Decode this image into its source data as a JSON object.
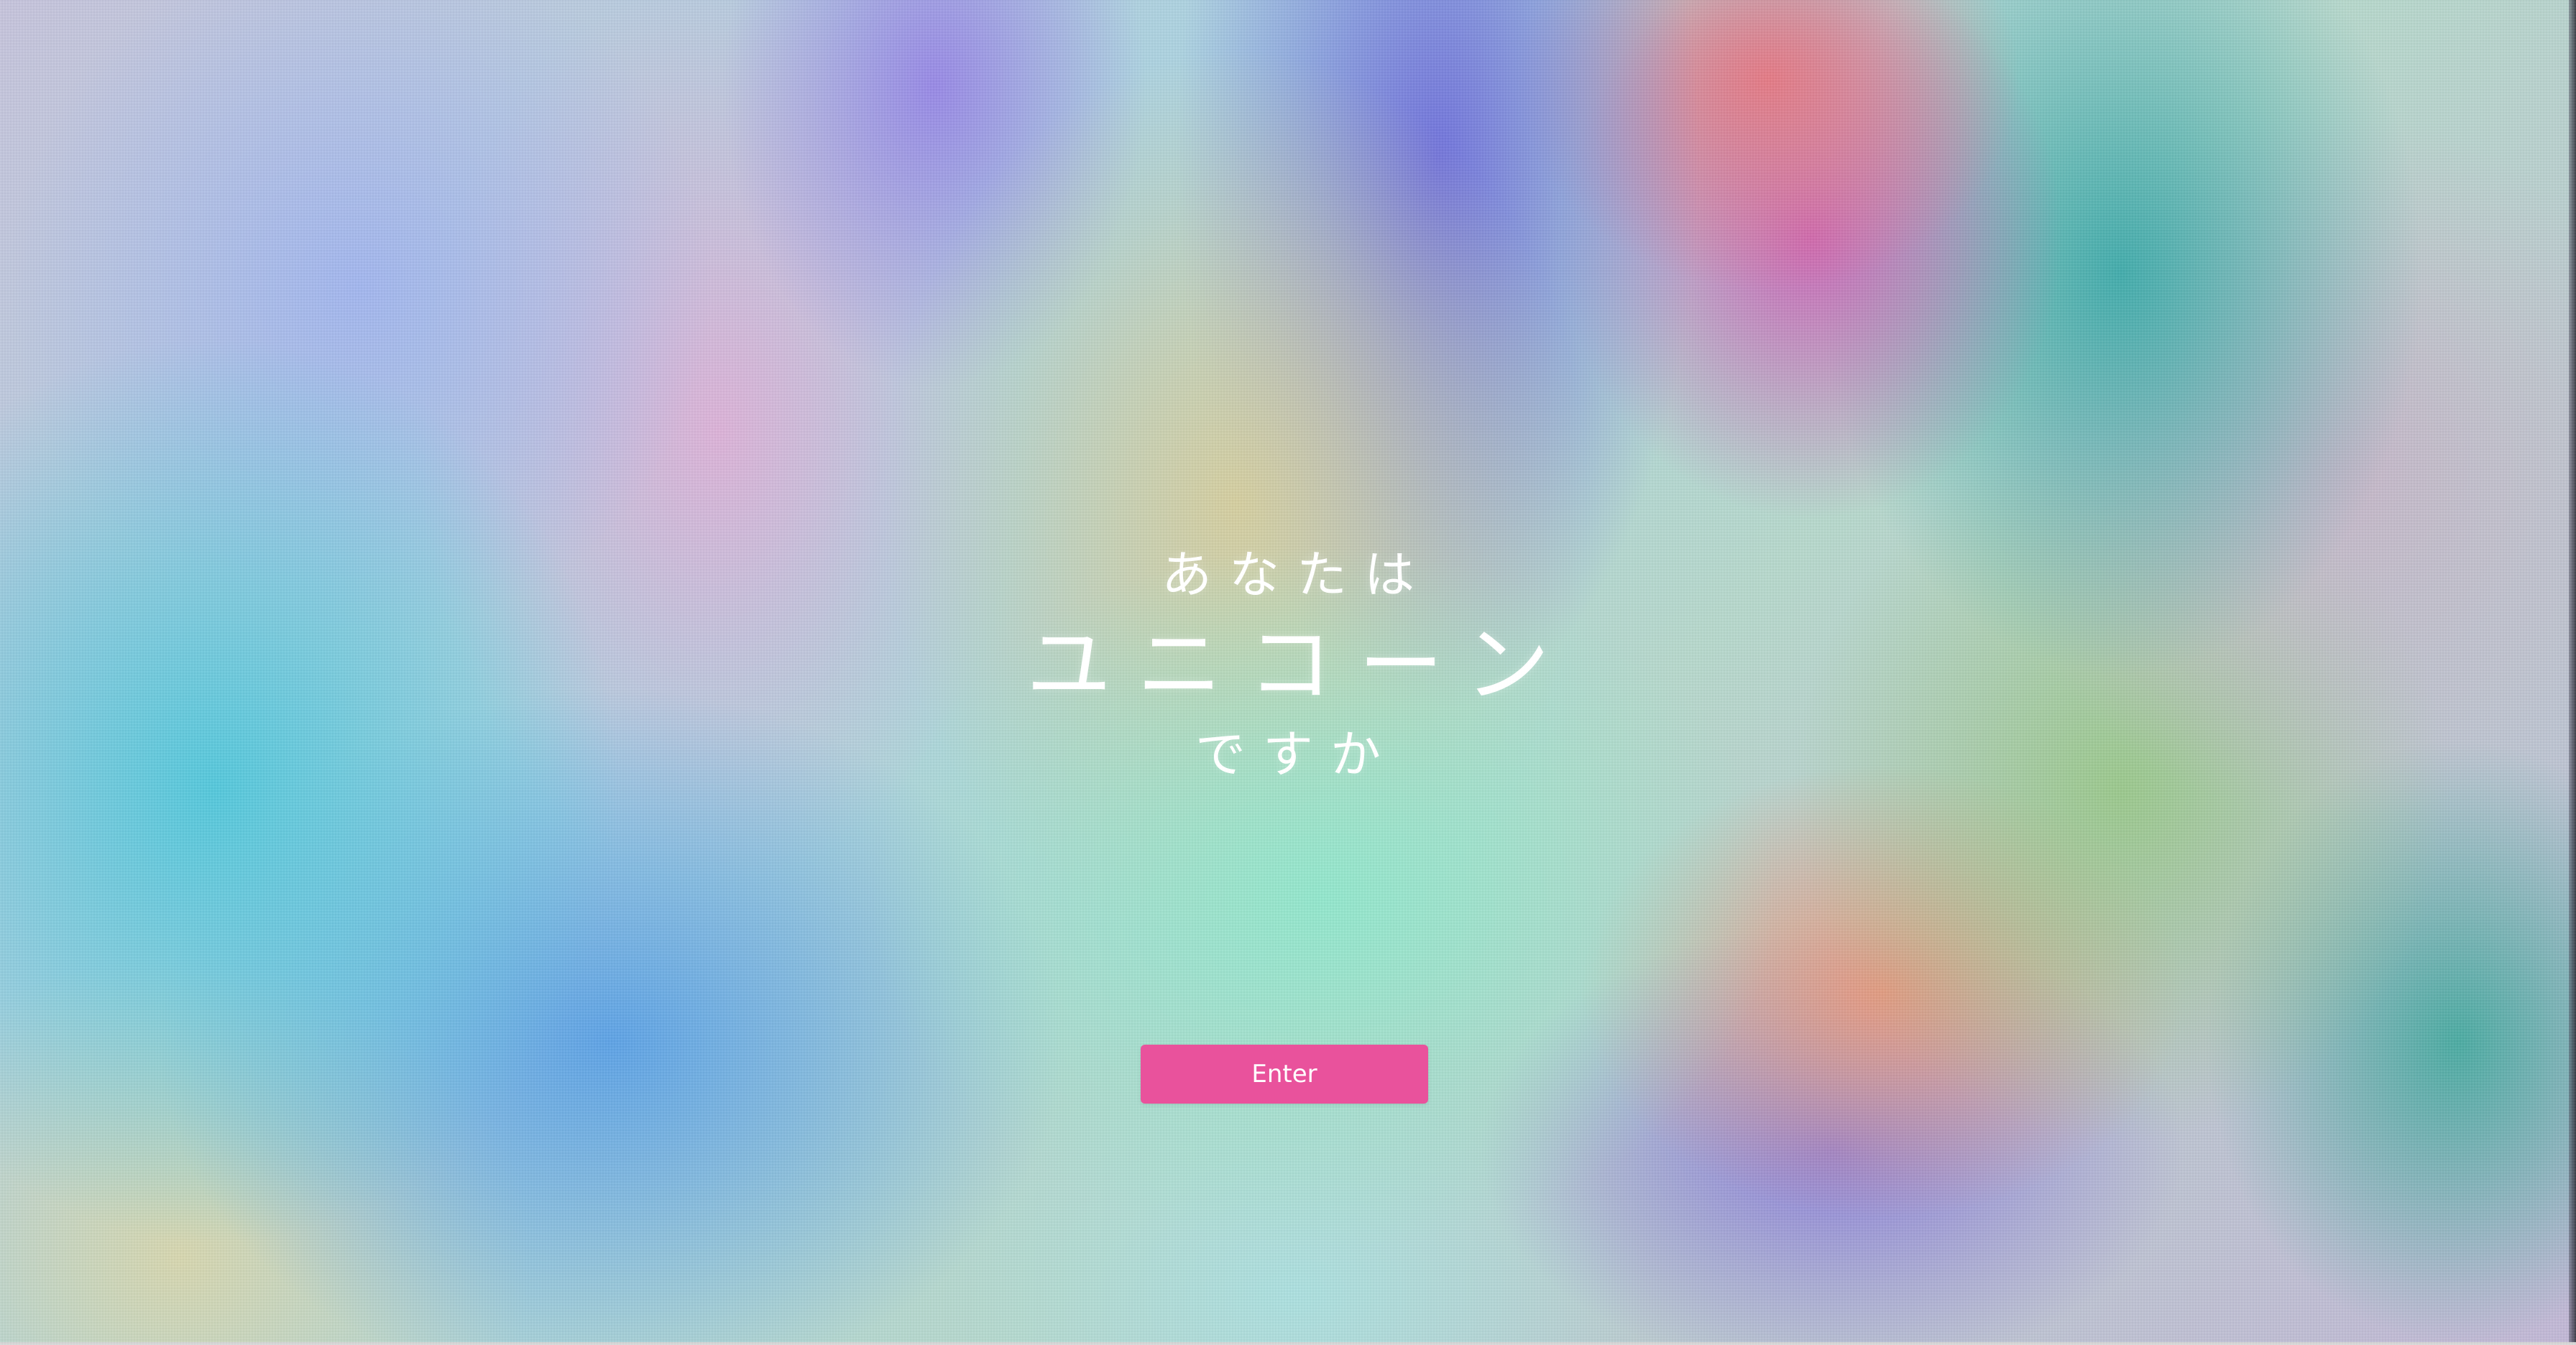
{
  "hero": {
    "line1": "あなたは",
    "line2": "ユニコーン",
    "line3": "ですか"
  },
  "cta": {
    "label": "Enter",
    "color": "#e9529c"
  },
  "background": {
    "style": "holographic-iridescent-gradient"
  }
}
